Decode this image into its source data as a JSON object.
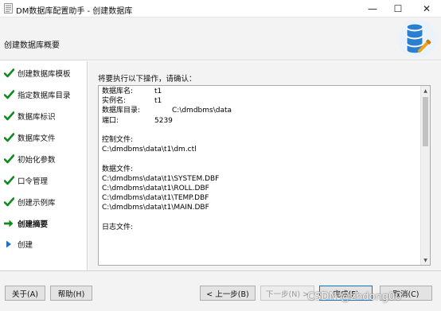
{
  "window": {
    "title": "DM数据库配置助手 - 创建数据库",
    "controls": {
      "minimize": "—",
      "maximize": "☐",
      "close": "✕"
    }
  },
  "header": {
    "title": "创建数据库概要"
  },
  "sidebar": {
    "steps": [
      {
        "label": "创建数据库模板",
        "status": "done"
      },
      {
        "label": "指定数据库目录",
        "status": "done"
      },
      {
        "label": "数据库标识",
        "status": "done"
      },
      {
        "label": "数据库文件",
        "status": "done"
      },
      {
        "label": "初始化参数",
        "status": "done"
      },
      {
        "label": "口令管理",
        "status": "done"
      },
      {
        "label": "创建示例库",
        "status": "done"
      },
      {
        "label": "创建摘要",
        "status": "current"
      },
      {
        "label": "创建",
        "status": "pending"
      }
    ]
  },
  "main": {
    "prompt": "将要执行以下操作，请确认：",
    "summary": {
      "db_name_label": "数据库名:",
      "db_name_value": "t1",
      "instance_label": "实例名:",
      "instance_value": "t1",
      "dir_label": "数据库目录:",
      "dir_value": "C:\\dmdbms\\data",
      "port_label": "端口:",
      "port_value": "5239",
      "control_file_label": "控制文件:",
      "control_file_value": "C:\\dmdbms\\data\\t1\\dm.ctl",
      "data_files_label": "数据文件:",
      "data_files": [
        "C:\\dmdbms\\data\\t1\\SYSTEM.DBF",
        "C:\\dmdbms\\data\\t1\\ROLL.DBF",
        "C:\\dmdbms\\data\\t1\\TEMP.DBF",
        "C:\\dmdbms\\data\\t1\\MAIN.DBF"
      ],
      "log_files_label": "日志文件:"
    }
  },
  "footer": {
    "about": "关于(A)",
    "help": "帮助(H)",
    "back": "< 上一步(B)",
    "next": "下一步(N) >",
    "finish": "完成(F)",
    "cancel": "取消(C)"
  },
  "watermark": "CSDN @zhdong00",
  "colors": {
    "check": "#0f8a1f",
    "current_arrow": "#0f8a1f",
    "pending": "#1e6fd0",
    "accent": "#0078d7"
  }
}
